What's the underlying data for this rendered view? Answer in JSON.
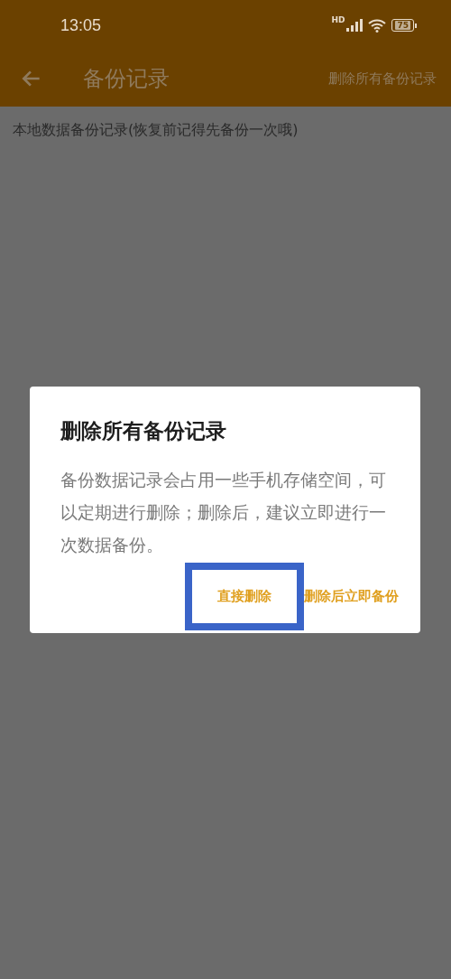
{
  "status_bar": {
    "time": "13:05",
    "network_badge": "HD",
    "battery": "75"
  },
  "app_bar": {
    "title": "备份记录",
    "action": "删除所有备份记录"
  },
  "subtitle": "本地数据备份记录(恢复前记得先备份一次哦)",
  "dialog": {
    "title": "删除所有备份记录",
    "message": "备份数据记录会占用一些手机存储空间，可以定期进行删除；删除后，建议立即进行一次数据备份。",
    "buttons": [
      {
        "label": "直接删除",
        "highlighted": true
      },
      {
        "label": "删除后立即备份",
        "highlighted": false
      }
    ]
  }
}
